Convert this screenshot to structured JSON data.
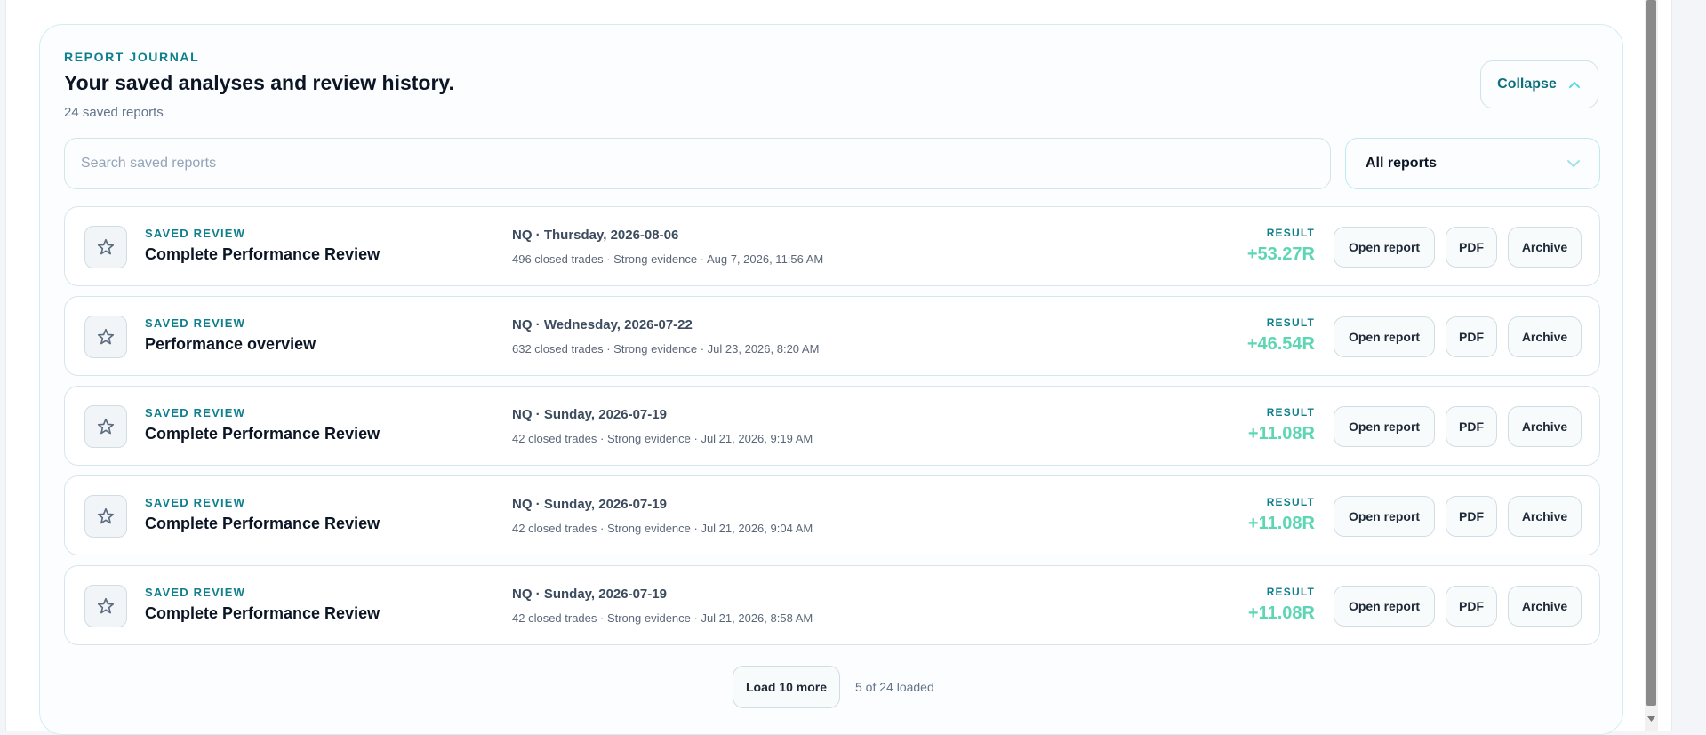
{
  "journal": {
    "eyebrow": "REPORT JOURNAL",
    "title": "Your saved analyses and review history.",
    "count": "24 saved reports",
    "collapse_label": "Collapse"
  },
  "search": {
    "placeholder": "Search saved reports"
  },
  "filter": {
    "selected": "All reports"
  },
  "reports": [
    {
      "kind": "SAVED REVIEW",
      "name": "Complete Performance Review",
      "session": "NQ · Thursday, 2026-08-06",
      "meta": "496 closed trades · Strong evidence · Aug 7, 2026, 11:56 AM",
      "result_label": "RESULT",
      "result": "+53.27R"
    },
    {
      "kind": "SAVED REVIEW",
      "name": "Performance overview",
      "session": "NQ · Wednesday, 2026-07-22",
      "meta": "632 closed trades · Strong evidence · Jul 23, 2026, 8:20 AM",
      "result_label": "RESULT",
      "result": "+46.54R"
    },
    {
      "kind": "SAVED REVIEW",
      "name": "Complete Performance Review",
      "session": "NQ · Sunday, 2026-07-19",
      "meta": "42 closed trades · Strong evidence · Jul 21, 2026, 9:19 AM",
      "result_label": "RESULT",
      "result": "+11.08R"
    },
    {
      "kind": "SAVED REVIEW",
      "name": "Complete Performance Review",
      "session": "NQ · Sunday, 2026-07-19",
      "meta": "42 closed trades · Strong evidence · Jul 21, 2026, 9:04 AM",
      "result_label": "RESULT",
      "result": "+11.08R"
    },
    {
      "kind": "SAVED REVIEW",
      "name": "Complete Performance Review",
      "session": "NQ · Sunday, 2026-07-19",
      "meta": "42 closed trades · Strong evidence · Jul 21, 2026, 8:58 AM",
      "result_label": "RESULT",
      "result": "+11.08R"
    }
  ],
  "actions": {
    "open": "Open report",
    "pdf": "PDF",
    "archive": "Archive"
  },
  "pagination": {
    "load_more": "Load 10 more",
    "loaded": "5 of 24 loaded"
  },
  "colors": {
    "accent": "#0e7f8c",
    "positive": "#5ed6b4"
  }
}
